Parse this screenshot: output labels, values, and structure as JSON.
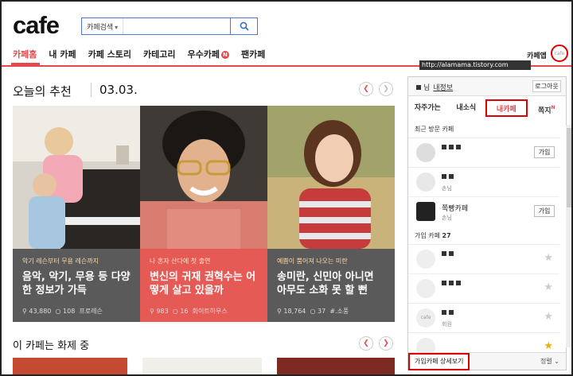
{
  "header": {
    "logo": "cafe",
    "search_select": "카페검색",
    "search_placeholder": ""
  },
  "nav": {
    "items": [
      "카페홈",
      "내 카페",
      "카페 스토리",
      "카테고리",
      "우수카페",
      "팬카페"
    ],
    "badge": "N",
    "cafe_app": "카페앱",
    "cafe_circle": "cafe"
  },
  "overlay_url": "http://alamama.tistory.com",
  "today": {
    "title": "오늘의 추천",
    "date": "03.03.",
    "cards": [
      {
        "sub": "악기 레슨부터 무용 레슨까지",
        "head": "음악, 악기, 무용 등 다양한 정보가 가득",
        "views": "43,880",
        "comments": "108",
        "cafe": "프로레슨"
      },
      {
        "sub": "나 혼자 산다에 첫 출연",
        "head": "변신의 귀재 권혁수는 어떻게 살고 있을까",
        "views": "983",
        "comments": "16",
        "cafe": "화이트하우스"
      },
      {
        "sub": "예쁨이 뿜어져 나오는 미란",
        "head": "송미란, 신민아 아니면 아무도 소화 못 할 뻔",
        "views": "18,764",
        "comments": "37",
        "cafe": "#.소풍"
      }
    ]
  },
  "topic": {
    "title": "이 카페는 화제 중"
  },
  "panel": {
    "user_suffix": "님",
    "info_link": "내정보",
    "logout": "로그아웃",
    "tabs": [
      "자주가는",
      "내소식",
      "내카페",
      "쪽지"
    ],
    "tab_badge": "N",
    "recent_label": "최근 방문 카페",
    "recent": [
      {
        "name": "",
        "role": "",
        "join": "가입"
      },
      {
        "name": "",
        "role": "손님",
        "join": ""
      },
      {
        "name": "쪽빵카페",
        "role": "손님",
        "join": "가입"
      }
    ],
    "joined_label": "가입 카페",
    "joined_count": "27",
    "joined": [
      {
        "name": "",
        "role": ""
      },
      {
        "name": "",
        "role": ""
      },
      {
        "name": "",
        "role": "회원"
      },
      {
        "name": "",
        "role": ""
      }
    ],
    "detail_button": "가입카페 상세보기",
    "sort": "정렬"
  },
  "colors": {
    "accent": "#e5484d",
    "highlight": "#dd0000"
  }
}
